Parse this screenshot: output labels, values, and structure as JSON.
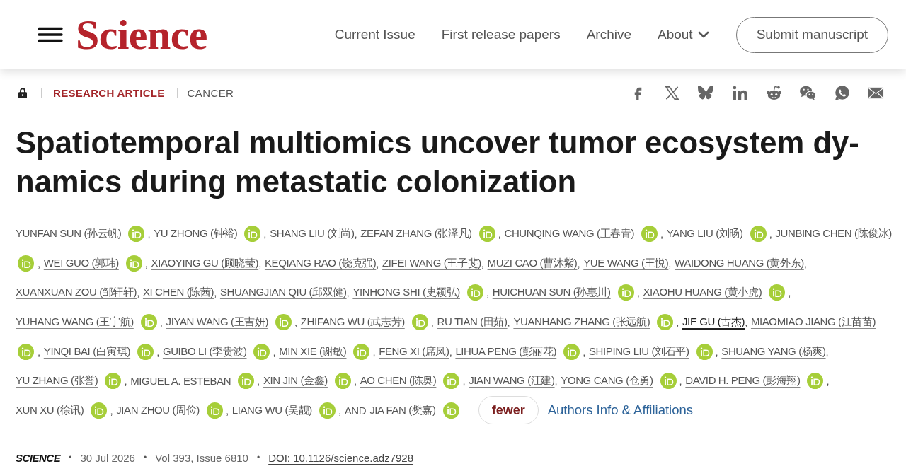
{
  "header": {
    "logo": "Science",
    "nav": [
      {
        "label": "Current Issue",
        "dropdown": false
      },
      {
        "label": "First release papers",
        "dropdown": false
      },
      {
        "label": "Archive",
        "dropdown": false
      },
      {
        "label": "About",
        "dropdown": true
      }
    ],
    "submit_button": "Submit manuscript"
  },
  "article": {
    "locked": true,
    "tags": [
      {
        "kind": "type",
        "label": "RESEARCH ARTICLE"
      },
      {
        "kind": "subject",
        "label": "CANCER"
      }
    ],
    "title_lines": [
      "Spatiotemporal multiomics uncover tumor ecosystem dy-",
      "namics during metastatic colonization"
    ],
    "authors": {
      "lines": [
        [
          {
            "kind": "author",
            "name": "YUNFAN SUN (孙云帆)",
            "orcid": true,
            "hovered": false,
            "sep": ","
          },
          {
            "kind": "author",
            "name": "YU ZHONG (钟裕)",
            "orcid": true,
            "hovered": false,
            "sep": ","
          },
          {
            "kind": "author",
            "name": "SHANG LIU (刘尚)",
            "orcid": false,
            "hovered": false,
            "sep": ","
          },
          {
            "kind": "author",
            "name": "ZEFAN ZHANG (张泽凡)",
            "orcid": true,
            "hovered": false,
            "sep": ","
          },
          {
            "kind": "author",
            "name": "CHUNQING WANG (王春青)",
            "orcid": true,
            "hovered": false,
            "sep": ","
          },
          {
            "kind": "author",
            "name": "YANG LIU (刘旸)",
            "orcid": true,
            "hovered": false,
            "sep": ","
          },
          {
            "kind": "author",
            "name": "JUNBING CHEN (陈俊冰)",
            "orcid": false,
            "hovered": false
          }
        ],
        [
          {
            "kind": "orcid",
            "orcid": true
          },
          {
            "kind": "author",
            "lead": ",",
            "name": "WEI GUO (郭玮)",
            "orcid": true,
            "hovered": false,
            "sep": ","
          },
          {
            "kind": "author",
            "name": "XIAOYING GU (顾晓莹)",
            "orcid": false,
            "hovered": false,
            "sep": ","
          },
          {
            "kind": "author",
            "name": "KEQIANG RAO (饶克强)",
            "orcid": false,
            "hovered": false,
            "sep": ","
          },
          {
            "kind": "author",
            "name": "ZIFEI WANG (王子斐)",
            "orcid": false,
            "hovered": false,
            "sep": ","
          },
          {
            "kind": "author",
            "name": "MUZI CAO (曹沐紫)",
            "orcid": false,
            "hovered": false,
            "sep": ","
          },
          {
            "kind": "author",
            "name": "YUE WANG (王悦)",
            "orcid": false,
            "hovered": false,
            "sep": ","
          },
          {
            "kind": "author",
            "name": "WAIDONG HUANG (黄外东)",
            "orcid": false,
            "hovered": false,
            "sep": ","
          }
        ],
        [
          {
            "kind": "author",
            "name": "XUANXUAN ZOU (邹轩轩)",
            "orcid": false,
            "hovered": false,
            "sep": ","
          },
          {
            "kind": "author",
            "name": "XI CHEN (陈茜)",
            "orcid": false,
            "hovered": false,
            "sep": ","
          },
          {
            "kind": "author",
            "name": "SHUANGJIAN QIU (邱双健)",
            "orcid": false,
            "hovered": false,
            "sep": ","
          },
          {
            "kind": "author",
            "name": "YINHONG SHI (史颖弘)",
            "orcid": true,
            "hovered": false,
            "sep": ","
          },
          {
            "kind": "author",
            "name": "HUICHUAN SUN (孙惠川)",
            "orcid": true,
            "hovered": false,
            "sep": ","
          },
          {
            "kind": "author",
            "name": "XIAOHU HUANG (黄小虎)",
            "orcid": true,
            "hovered": false,
            "sep": ","
          }
        ],
        [
          {
            "kind": "author",
            "name": "YUHANG WANG (王宇航)",
            "orcid": true,
            "hovered": false,
            "sep": ","
          },
          {
            "kind": "author",
            "name": "JIYAN WANG (王吉妍)",
            "orcid": true,
            "hovered": false,
            "sep": ","
          },
          {
            "kind": "author",
            "name": "ZHIFANG WU (武志芳)",
            "orcid": true,
            "hovered": false,
            "sep": ","
          },
          {
            "kind": "author",
            "name": "RU TIAN (田茹)",
            "orcid": false,
            "hovered": false,
            "sep": ","
          },
          {
            "kind": "author",
            "name": "YUANHANG ZHANG (张远航)",
            "orcid": true,
            "hovered": false,
            "sep": ","
          },
          {
            "kind": "author",
            "name": "JIE GU (古杰)",
            "orcid": false,
            "hovered": true,
            "sep": ","
          },
          {
            "kind": "author",
            "name": "MIAOMIAO JIANG (江苗苗)",
            "orcid": false,
            "hovered": false
          }
        ],
        [
          {
            "kind": "orcid",
            "orcid": true
          },
          {
            "kind": "author",
            "lead": ",",
            "name": "YINQI BAI (白寅琪)",
            "orcid": true,
            "hovered": false,
            "sep": ","
          },
          {
            "kind": "author",
            "name": "GUIBO LI (李贵波)",
            "orcid": true,
            "hovered": false,
            "sep": ","
          },
          {
            "kind": "author",
            "name": "MIN XIE (谢敏)",
            "orcid": true,
            "hovered": false,
            "sep": ","
          },
          {
            "kind": "author",
            "name": "FENG XI (席凤)",
            "orcid": false,
            "hovered": false,
            "sep": ","
          },
          {
            "kind": "author",
            "name": "LIHUA PENG (彭丽花)",
            "orcid": true,
            "hovered": false,
            "sep": ","
          },
          {
            "kind": "author",
            "name": "SHIPING LIU (刘石平)",
            "orcid": true,
            "hovered": false,
            "sep": ","
          },
          {
            "kind": "author",
            "name": "SHUANG YANG (杨爽)",
            "orcid": false,
            "hovered": false,
            "sep": ","
          }
        ],
        [
          {
            "kind": "author",
            "name": "YU ZHANG (张誉)",
            "orcid": true,
            "hovered": false,
            "sep": ","
          },
          {
            "kind": "author",
            "name": "MIGUEL A. ESTEBAN",
            "orcid": true,
            "hovered": false,
            "sep": ","
          },
          {
            "kind": "author",
            "name": "XIN JIN (金鑫)",
            "orcid": true,
            "hovered": false,
            "sep": ","
          },
          {
            "kind": "author",
            "name": "AO CHEN (陈奥)",
            "orcid": true,
            "hovered": false,
            "sep": ","
          },
          {
            "kind": "author",
            "name": "JIAN WANG (汪建)",
            "orcid": false,
            "hovered": false,
            "sep": ","
          },
          {
            "kind": "author",
            "name": "YONG CANG (仓勇)",
            "orcid": true,
            "hovered": false,
            "sep": ","
          },
          {
            "kind": "author",
            "name": "DAVID H. PENG (彭海翔)",
            "orcid": true,
            "hovered": false,
            "sep": ","
          }
        ],
        [
          {
            "kind": "author",
            "name": "XUN XU (徐讯)",
            "orcid": true,
            "hovered": false,
            "sep": ","
          },
          {
            "kind": "author",
            "name": "JIAN ZHOU (周俭)",
            "orcid": true,
            "hovered": false,
            "sep": ","
          },
          {
            "kind": "author",
            "name": "LIANG WU (吴靓)",
            "orcid": true,
            "hovered": false,
            "sep": ","
          },
          {
            "kind": "text",
            "text": "AND"
          },
          {
            "kind": "author",
            "name": "JIA FAN (樊嘉)",
            "orcid": true,
            "hovered": false
          }
        ]
      ],
      "toggle_button": "fewer",
      "affiliations_link": "Authors Info & Affiliations"
    },
    "meta": [
      {
        "kind": "journal",
        "text": "SCIENCE"
      },
      {
        "kind": "bullet",
        "text": "•"
      },
      {
        "kind": "plain",
        "text": "30 Jul 2026"
      },
      {
        "kind": "bullet",
        "text": "•"
      },
      {
        "kind": "plain",
        "text": "Vol 393, Issue 6810"
      },
      {
        "kind": "bullet",
        "text": "•"
      },
      {
        "kind": "link",
        "text": "DOI: 10.1126/science.adz7928"
      }
    ]
  }
}
